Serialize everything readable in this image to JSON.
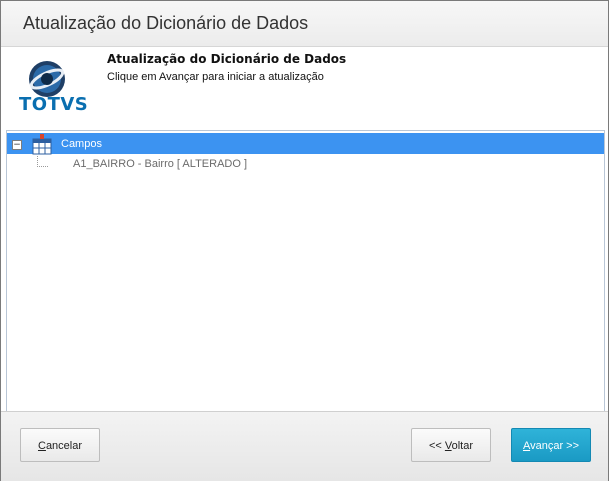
{
  "window": {
    "title": "Atualização do Dicionário de Dados"
  },
  "header": {
    "logo_text": "TOTVS",
    "title": "Atualização do Dicionário de Dados",
    "subtitle": "Clique em Avançar para iniciar a atualização"
  },
  "tree": {
    "expander": "−",
    "root": {
      "label": "Campos",
      "icon": "table-icon",
      "selected": true
    },
    "children": [
      {
        "label": "A1_BAIRRO - Bairro  [ ALTERADO ]"
      }
    ]
  },
  "footer": {
    "cancel_mnemonic": "C",
    "cancel_rest": "ancelar",
    "back_prefix": "<< ",
    "back_mnemonic": "V",
    "back_rest": "oltar",
    "next_mnemonic": "A",
    "next_rest": "vançar >>"
  },
  "colors": {
    "selection": "#3c93f1",
    "primary_button": "#1a9ac4",
    "brand": "#0a6fb0"
  }
}
